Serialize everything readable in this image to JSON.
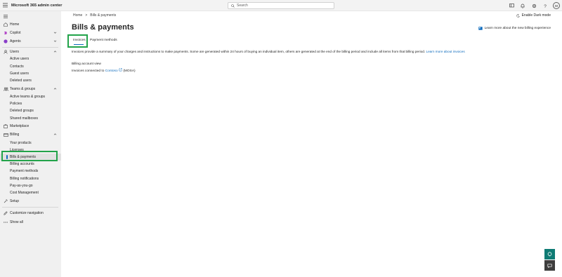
{
  "app_title": "Microsoft 365 admin center",
  "search": {
    "placeholder": "Search"
  },
  "user_initials": "M",
  "sidebar": {
    "items": [
      {
        "label": "Home",
        "icon": "home-icon"
      },
      {
        "label": "Copilot",
        "icon": "copilot-icon"
      },
      {
        "label": "Agents",
        "icon": "agents-icon"
      },
      {
        "label": "Users",
        "icon": "users-icon"
      },
      {
        "label": "Active users"
      },
      {
        "label": "Contacts"
      },
      {
        "label": "Guest users"
      },
      {
        "label": "Deleted users"
      },
      {
        "label": "Teams & groups",
        "icon": "teams-icon"
      },
      {
        "label": "Active teams & groups"
      },
      {
        "label": "Policies"
      },
      {
        "label": "Deleted groups"
      },
      {
        "label": "Shared mailboxes"
      },
      {
        "label": "Marketplace",
        "icon": "marketplace-icon"
      },
      {
        "label": "Billing",
        "icon": "billing-icon"
      },
      {
        "label": "Your products"
      },
      {
        "label": "Licenses"
      },
      {
        "label": "Bills & payments"
      },
      {
        "label": "Billing accounts"
      },
      {
        "label": "Payment methods"
      },
      {
        "label": "Billing notifications"
      },
      {
        "label": "Pay-as-you-go"
      },
      {
        "label": "Cost Management"
      },
      {
        "label": "Setup",
        "icon": "setup-icon"
      },
      {
        "label": "Customize navigation",
        "icon": "customize-icon"
      },
      {
        "label": "Show all",
        "icon": "ellipsis-icon"
      }
    ]
  },
  "breadcrumb": {
    "home": "Home",
    "sep": ">",
    "current": "Bills & payments"
  },
  "dark_mode_label": "Enable Dark mode",
  "page_title": "Bills & payments",
  "learn_new_label": "Learn more about the new billing experience",
  "tabs": [
    {
      "label": "Invoices"
    },
    {
      "label": "Payment methods"
    }
  ],
  "description": {
    "text": "Invoices provide a summary of your charges and instructions to make payments. Some are generated within 24 hours of buying an individual item, others are generated at the end of the billing period and include all items from that billing period.",
    "link": "Learn more about invoices"
  },
  "billing_account_view": "Billing account view",
  "invoices_connected": {
    "prefix": "Invoices connected to",
    "link": "Contoso",
    "suffix": "(MOSA)"
  },
  "colors": {
    "accent": "#0f6cbd",
    "highlight": "#22a34a",
    "sidebar_bg": "#f0f0f0"
  }
}
